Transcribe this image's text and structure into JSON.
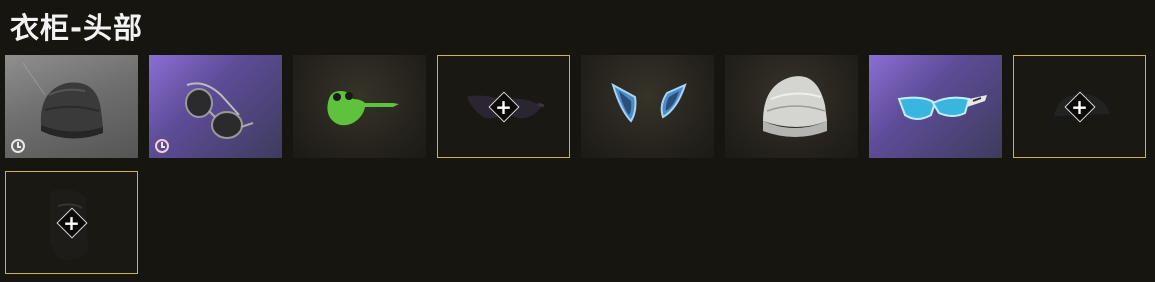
{
  "page": {
    "title": "衣柜-头部"
  },
  "colors": {
    "background": "#171510",
    "equipped_border": "#c9b25c",
    "purple_rarity": "#8a6fd3",
    "grey_rarity": "#8f8f8f",
    "dark_rarity": "#2e2c24"
  },
  "add_symbol": "+",
  "items": [
    {
      "name": "beanie-black",
      "icon": "beanie-icon",
      "rarity": "grey",
      "timed": true
    },
    {
      "name": "aviator-sunglasses",
      "icon": "aviator-sunglasses-icon",
      "rarity": "purple",
      "timed": true
    },
    {
      "name": "frog-mask",
      "icon": "frog-mask-icon",
      "rarity": "dark",
      "timed": false
    },
    {
      "name": "dark-sunglasses-slot",
      "icon": "sunglasses-icon",
      "rarity": "empty",
      "equipped": true,
      "add": true
    },
    {
      "name": "cat-ears",
      "icon": "cat-ears-icon",
      "rarity": "dark",
      "timed": false
    },
    {
      "name": "beanie-white",
      "icon": "knit-beanie-icon",
      "rarity": "dark",
      "timed": false
    },
    {
      "name": "blue-sport-sunglasses",
      "icon": "sport-sunglasses-icon",
      "rarity": "purple",
      "timed": false
    },
    {
      "name": "cap-slot",
      "icon": "cap-icon",
      "rarity": "empty",
      "equipped": true,
      "add": true
    },
    {
      "name": "balaclava-slot",
      "icon": "balaclava-icon",
      "rarity": "empty",
      "equipped": true,
      "add": true
    }
  ]
}
